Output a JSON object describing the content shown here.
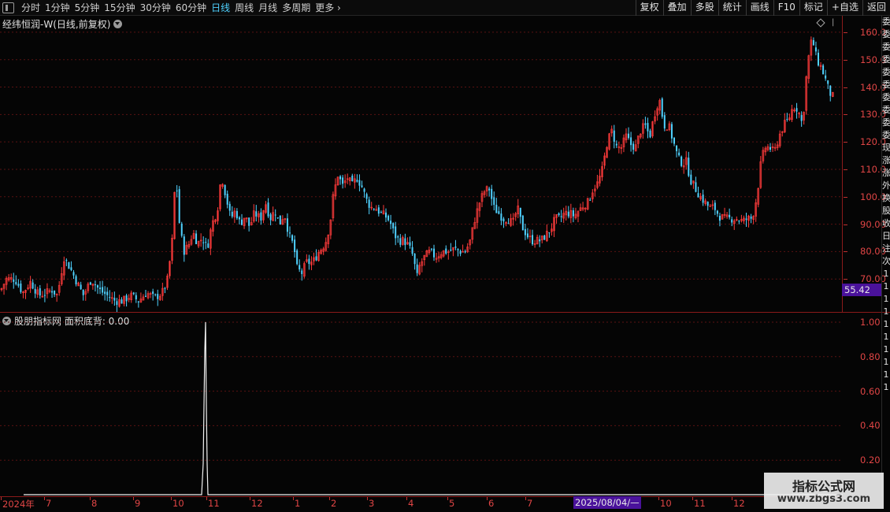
{
  "toolbar": {
    "tabs": [
      {
        "label": "分时",
        "active": false
      },
      {
        "label": "1分钟",
        "active": false
      },
      {
        "label": "5分钟",
        "active": false
      },
      {
        "label": "15分钟",
        "active": false
      },
      {
        "label": "30分钟",
        "active": false
      },
      {
        "label": "60分钟",
        "active": false
      },
      {
        "label": "日线",
        "active": true
      },
      {
        "label": "周线",
        "active": false
      },
      {
        "label": "月线",
        "active": false
      },
      {
        "label": "多周期",
        "active": false
      }
    ],
    "more_label": "更多",
    "right_buttons": [
      "复权",
      "叠加",
      "多股",
      "统计",
      "画线",
      "F10",
      "标记",
      "+自选",
      "返回"
    ]
  },
  "main_chart": {
    "title": "经纬恒润-W(日线,前复权)",
    "price_ticks": [
      "160.0",
      "150.0",
      "140.0",
      "130.0",
      "120.0",
      "110.0",
      "100.0",
      "90.00",
      "80.00",
      "70.00"
    ],
    "current_price": "55.42"
  },
  "indicator": {
    "title": "股朋指标网 面积底背: 0.00",
    "ticks": [
      "1.00",
      "0.80",
      "0.60",
      "0.40",
      "0.20"
    ]
  },
  "time_axis": {
    "labels": [
      "2024年",
      "7",
      "8",
      "9",
      "10",
      "11",
      "12",
      "1",
      "2",
      "3",
      "4",
      "5",
      "6",
      "7",
      "10",
      "11",
      "12"
    ],
    "cursor_label": "2025/08/04/—"
  },
  "right_strip": [
    "委",
    "委",
    "委",
    "委",
    "委",
    "委",
    "委",
    "委",
    "委",
    "委",
    "现",
    "涨",
    "涨",
    "外",
    "换",
    "股",
    "收",
    "日",
    "注",
    "次",
    "1",
    "1",
    "1",
    "1",
    "1",
    "1",
    "1",
    "1",
    "1",
    "1"
  ],
  "watermark": {
    "title": "指标公式网",
    "url": "www.zbgs3.com"
  },
  "chart_data": [
    {
      "type": "candlestick",
      "title": "经纬恒润-W(日线,前复权)",
      "ylim": [
        58,
        166
      ],
      "up_color": "#ff3b3b",
      "down_color": "#4fd2ff",
      "close_trend": [
        [
          0,
          66
        ],
        [
          7,
          70
        ],
        [
          18,
          70
        ],
        [
          28,
          65
        ],
        [
          38,
          69
        ],
        [
          48,
          64
        ],
        [
          58,
          65
        ],
        [
          65,
          66
        ],
        [
          72,
          64
        ],
        [
          80,
          78
        ],
        [
          88,
          74
        ],
        [
          98,
          68
        ],
        [
          105,
          64
        ],
        [
          115,
          70
        ],
        [
          125,
          66
        ],
        [
          135,
          64
        ],
        [
          145,
          62
        ],
        [
          155,
          62
        ],
        [
          165,
          64
        ],
        [
          175,
          62
        ],
        [
          185,
          65
        ],
        [
          195,
          63
        ],
        [
          205,
          65
        ],
        [
          212,
          70
        ],
        [
          218,
          85
        ],
        [
          222,
          110
        ],
        [
          226,
          92
        ],
        [
          232,
          80
        ],
        [
          238,
          82
        ],
        [
          244,
          87
        ],
        [
          250,
          83
        ],
        [
          256,
          85
        ],
        [
          262,
          81
        ],
        [
          268,
          90
        ],
        [
          275,
          95
        ],
        [
          280,
          108
        ],
        [
          286,
          100
        ],
        [
          292,
          92
        ],
        [
          298,
          95
        ],
        [
          304,
          90
        ],
        [
          310,
          93
        ],
        [
          316,
          89
        ],
        [
          322,
          94
        ],
        [
          330,
          92
        ],
        [
          336,
          98
        ],
        [
          342,
          92
        ],
        [
          348,
          95
        ],
        [
          354,
          90
        ],
        [
          360,
          94
        ],
        [
          366,
          86
        ],
        [
          372,
          82
        ],
        [
          376,
          74
        ],
        [
          382,
          72
        ],
        [
          388,
          76
        ],
        [
          396,
          76
        ],
        [
          404,
          80
        ],
        [
          412,
          83
        ],
        [
          418,
          90
        ],
        [
          422,
          100
        ],
        [
          428,
          108
        ],
        [
          434,
          104
        ],
        [
          440,
          107
        ],
        [
          446,
          104
        ],
        [
          452,
          107
        ],
        [
          458,
          104
        ],
        [
          464,
          99
        ],
        [
          470,
          96
        ],
        [
          476,
          96
        ],
        [
          482,
          94
        ],
        [
          488,
          93
        ],
        [
          494,
          91
        ],
        [
          500,
          86
        ],
        [
          506,
          84
        ],
        [
          512,
          84
        ],
        [
          518,
          82
        ],
        [
          524,
          78
        ],
        [
          528,
          70
        ],
        [
          532,
          75
        ],
        [
          538,
          78
        ],
        [
          545,
          80
        ],
        [
          552,
          78
        ],
        [
          560,
          80
        ],
        [
          568,
          80
        ],
        [
          576,
          81
        ],
        [
          584,
          80
        ],
        [
          590,
          80
        ],
        [
          596,
          84
        ],
        [
          602,
          92
        ],
        [
          608,
          98
        ],
        [
          614,
          102
        ],
        [
          620,
          103
        ],
        [
          626,
          96
        ],
        [
          632,
          94
        ],
        [
          638,
          92
        ],
        [
          644,
          92
        ],
        [
          650,
          90
        ],
        [
          656,
          96
        ],
        [
          662,
          89
        ],
        [
          668,
          86
        ],
        [
          674,
          84
        ],
        [
          680,
          84
        ],
        [
          686,
          84
        ],
        [
          692,
          86
        ],
        [
          698,
          88
        ],
        [
          704,
          92
        ],
        [
          710,
          92
        ],
        [
          716,
          94
        ],
        [
          722,
          94
        ],
        [
          728,
          93
        ],
        [
          734,
          95
        ],
        [
          740,
          97
        ],
        [
          746,
          98
        ],
        [
          752,
          103
        ],
        [
          758,
          105
        ],
        [
          764,
          110
        ],
        [
          770,
          120
        ],
        [
          776,
          124
        ],
        [
          782,
          118
        ],
        [
          788,
          118
        ],
        [
          794,
          122
        ],
        [
          800,
          119
        ],
        [
          806,
          118
        ],
        [
          812,
          124
        ],
        [
          818,
          126
        ],
        [
          824,
          122
        ],
        [
          830,
          130
        ],
        [
          836,
          136
        ],
        [
          842,
          126
        ],
        [
          848,
          126
        ],
        [
          854,
          120
        ],
        [
          860,
          114
        ],
        [
          866,
          112
        ],
        [
          870,
          113
        ],
        [
          876,
          106
        ],
        [
          882,
          103
        ],
        [
          888,
          100
        ],
        [
          894,
          98
        ],
        [
          900,
          96
        ],
        [
          906,
          96
        ],
        [
          912,
          93
        ],
        [
          918,
          92
        ],
        [
          924,
          92
        ],
        [
          930,
          92
        ],
        [
          936,
          92
        ],
        [
          942,
          91
        ],
        [
          948,
          92
        ],
        [
          954,
          92
        ],
        [
          960,
          100
        ],
        [
          965,
          112
        ],
        [
          970,
          118
        ],
        [
          976,
          118
        ],
        [
          982,
          116
        ],
        [
          988,
          122
        ],
        [
          994,
          126
        ],
        [
          1000,
          128
        ],
        [
          1006,
          133
        ],
        [
          1012,
          132
        ],
        [
          1018,
          126
        ],
        [
          1024,
          148
        ],
        [
          1030,
          158
        ],
        [
          1036,
          150
        ],
        [
          1042,
          147
        ],
        [
          1048,
          142
        ],
        [
          1052,
          138
        ],
        [
          1058,
          136
        ]
      ]
    },
    {
      "type": "line",
      "title": "股朋指标网 面积底背: 0.00",
      "ylim": [
        0,
        1.05
      ],
      "series": [
        {
          "name": "面积底背",
          "points": [
            [
              30,
              0
            ],
            [
              256,
              0
            ],
            [
              258,
              0.18
            ],
            [
              259,
              0.52
            ],
            [
              260,
              0.83
            ],
            [
              261,
              1.0
            ],
            [
              262,
              0.52
            ],
            [
              263,
              0.18
            ],
            [
              264,
              0
            ],
            [
              1070,
              0
            ]
          ]
        }
      ]
    }
  ]
}
